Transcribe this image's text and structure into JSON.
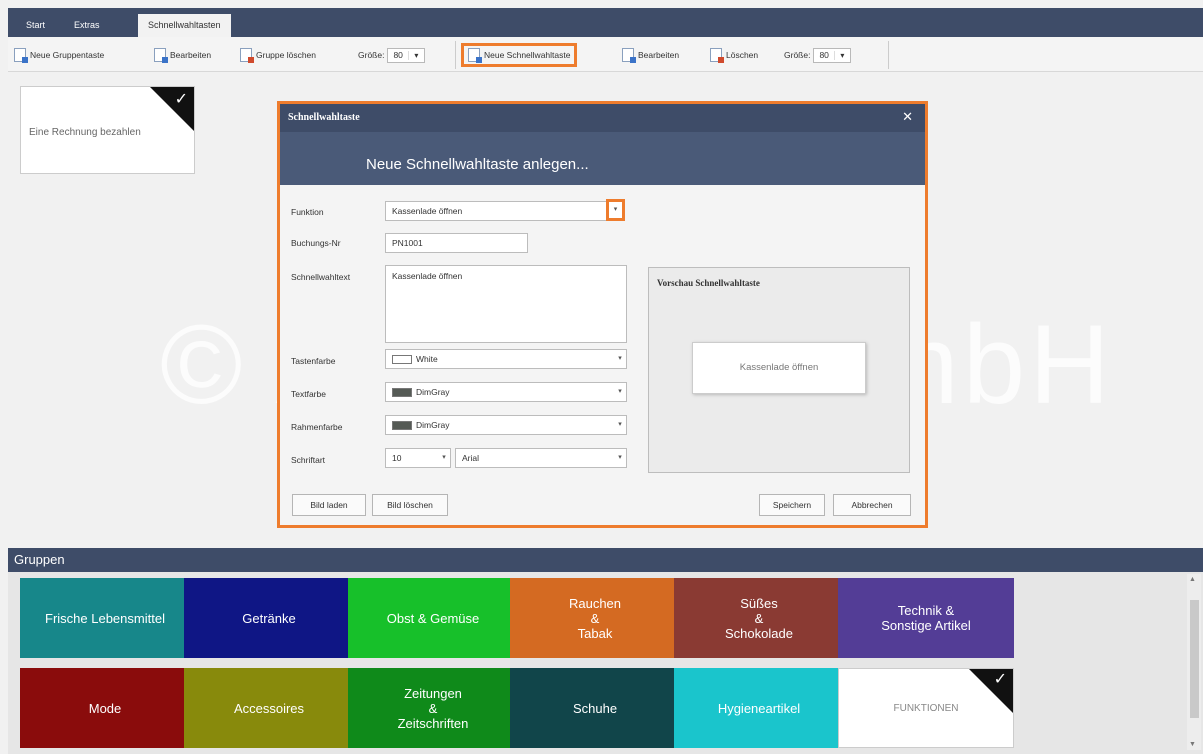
{
  "tabs": [
    "Start",
    "Extras",
    "Schnellwahltasten"
  ],
  "toolbar": {
    "new_group_label": "Neue Gruppentaste",
    "edit_group_label": "Bearbeiten",
    "delete_group_label": "Gruppe löschen",
    "group_size_label": "Größe:",
    "group_size_value": "80",
    "new_quick_label": "Neue Schnellwahltaste",
    "edit_quick_label": "Bearbeiten",
    "delete_quick_label": "Löschen",
    "quick_size_label": "Größe:",
    "quick_size_value": "80"
  },
  "workspace": {
    "tile_label": "Eine Rechnung bezahlen",
    "watermark": "© Ascendo GmbH"
  },
  "dialog": {
    "title": "Schnellwahltaste",
    "header": "Neue Schnellwahltaste anlegen...",
    "function_label": "Funktion",
    "function_value": "Kassenlade öffnen",
    "booking_label": "Buchungs-Nr",
    "booking_value": "PN1001",
    "quicktext_label": "Schnellwahltext",
    "quicktext_value": "Kassenlade öffnen",
    "keycolor_label": "Tastenfarbe",
    "keycolor_value": "White",
    "fontcolor_label": "Textfarbe",
    "fontcolor_value": "DimGray",
    "framecolor_label": "Rahmenfarbe",
    "framecolor_value": "DimGray",
    "font_label": "Schriftart",
    "font_size_value": "10",
    "font_name_value": "Arial",
    "preview_title": "Vorschau Schnellwahltaste",
    "preview_button_text": "Kassenlade öffnen",
    "load_image_label": "Bild laden",
    "delete_image_label": "Bild löschen",
    "save_label": "Speichern",
    "cancel_label": "Abbrechen",
    "colors": {
      "white": "#ffffff",
      "dimgray": "#555a55"
    }
  },
  "groups": {
    "title": "Gruppen",
    "tiles": [
      {
        "label": "Frische Lebensmittel",
        "color": "#17878a"
      },
      {
        "label": "Getränke",
        "color": "#0f1685"
      },
      {
        "label": "Obst & Gemüse",
        "color": "#17c02a"
      },
      {
        "label": "Rauchen\n&\nTabak",
        "color": "#d46a22"
      },
      {
        "label": "Süßes\n&\nSchokolade",
        "color": "#8a3a33"
      },
      {
        "label": "Technik &\nSonstige Artikel",
        "color": "#533d96"
      },
      {
        "label": "Mode",
        "color": "#8a0c0c"
      },
      {
        "label": "Accessoires",
        "color": "#888a0c"
      },
      {
        "label": "Zeitungen\n&\nZeitschriften",
        "color": "#0f8a1a"
      },
      {
        "label": "Schuhe",
        "color": "#11454a"
      },
      {
        "label": "Hygieneartikel",
        "color": "#1ac5cc"
      },
      {
        "label": "FUNKTIONEN",
        "color": "#ffffff"
      }
    ]
  }
}
